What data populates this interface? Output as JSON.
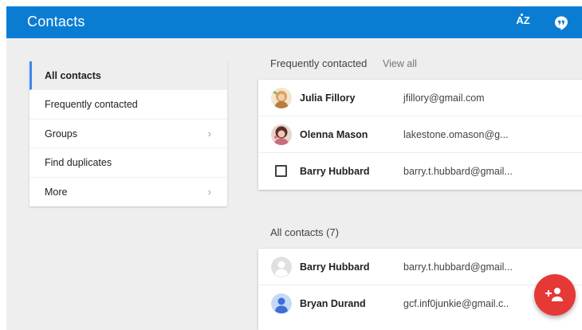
{
  "app": {
    "title": "Contacts"
  },
  "toolbar": {
    "sort_label": "AZ",
    "hangouts_icon": "hangouts-icon"
  },
  "nav": {
    "items": [
      {
        "label": "All contacts",
        "active": true,
        "chevron": false
      },
      {
        "label": "Frequently contacted",
        "active": false,
        "chevron": false
      },
      {
        "label": "Groups",
        "active": false,
        "chevron": true
      },
      {
        "label": "Find duplicates",
        "active": false,
        "chevron": false
      },
      {
        "label": "More",
        "active": false,
        "chevron": true
      }
    ],
    "chevron_glyph": "›"
  },
  "frequent": {
    "header": "Frequently contacted",
    "view_all": "View all",
    "contacts": [
      {
        "name": "Julia Fillory",
        "email": "jfillory@gmail.com",
        "avatar": "photo-julia"
      },
      {
        "name": "Olenna Mason",
        "email": "lakestone.omason@g...",
        "avatar": "photo-olenna"
      },
      {
        "name": "Barry Hubbard",
        "email": "barry.t.hubbard@gmail...",
        "avatar": "checkbox"
      }
    ]
  },
  "all": {
    "header": "All contacts (7)",
    "contacts": [
      {
        "name": "Barry Hubbard",
        "email": "barry.t.hubbard@gmail...",
        "avatar": "default-grey"
      },
      {
        "name": "Bryan Durand",
        "email": "gcf.inf0junkie@gmail.c..",
        "avatar": "default-blue"
      }
    ]
  },
  "fab": {
    "icon": "add-person-icon"
  },
  "colors": {
    "appbar": "#0a7dd3",
    "nav_active_indicator": "#4285f4",
    "fab": "#e53935"
  }
}
